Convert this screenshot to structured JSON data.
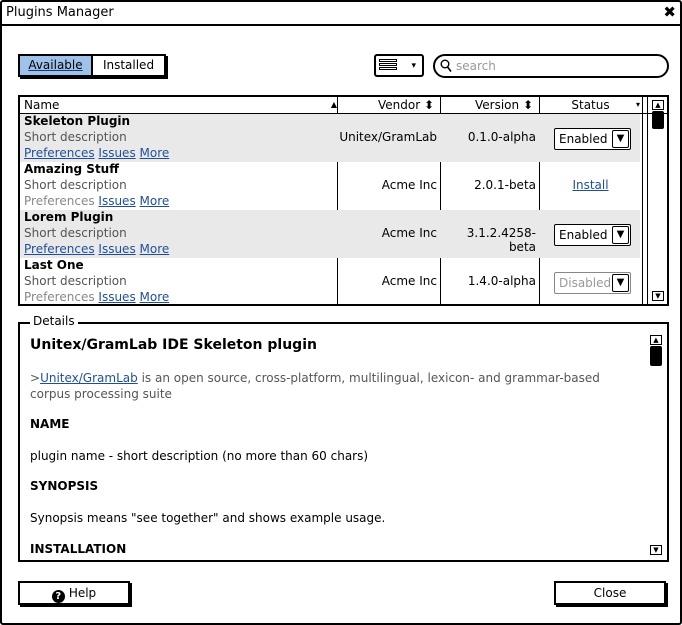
{
  "window": {
    "title": "Plugins Manager",
    "close_glyph": "✖"
  },
  "toolbar": {
    "tabs": [
      {
        "label": "Available",
        "active": true
      },
      {
        "label": "Installed",
        "active": false
      }
    ],
    "view_icon": "list-view-icon",
    "view_caret": "▾",
    "search": {
      "placeholder": "search",
      "value": ""
    }
  },
  "table": {
    "columns": {
      "name": "Name",
      "name_sort": "▲",
      "vendor": "Vendor ⬍",
      "version": "Version ⬍",
      "status": "Status",
      "status_dd": "▾"
    },
    "rows": [
      {
        "name": "Skeleton Plugin",
        "desc": "Short description",
        "links": [
          "Preferences",
          "Issues",
          "More"
        ],
        "prefs_enabled": true,
        "vendor": "Unitex/GramLab",
        "version": "0.1.0-alpha",
        "status": "Enabled",
        "status_type": "select"
      },
      {
        "name": "Amazing Stuff",
        "desc": "Short description",
        "links": [
          "Preferences",
          "Issues",
          "More"
        ],
        "prefs_enabled": false,
        "vendor": "Acme Inc",
        "version": "2.0.1-beta",
        "status": "Install",
        "status_type": "link"
      },
      {
        "name": "Lorem Plugin",
        "desc": "Short description",
        "links": [
          "Preferences",
          "Issues",
          "More"
        ],
        "prefs_enabled": true,
        "vendor": "Acme Inc",
        "version": "3.1.2.4258-beta",
        "status": "Enabled",
        "status_type": "select"
      },
      {
        "name": "Last One",
        "desc": "Short description",
        "links": [
          "Preferences",
          "Issues",
          "More"
        ],
        "prefs_enabled": false,
        "vendor": "Acme Inc",
        "version": "1.4.0-alpha",
        "status": "Disabled",
        "status_type": "select-disabled"
      }
    ],
    "select_arrow": "▼"
  },
  "details": {
    "legend": "Details",
    "title": "Unitex/GramLab IDE Skeleton plugin",
    "intro_prefix": ">",
    "intro_link": "Unitex/GramLab",
    "intro_text": " is an open source, cross-platform, multilingual, lexicon- and grammar-based corpus processing suite",
    "sections": [
      {
        "heading": "NAME",
        "text": "plugin name - short description (no more than 60 chars)"
      },
      {
        "heading": "SYNOPSIS",
        "text": "Synopsis means \"see together\" and shows example usage."
      },
      {
        "heading": "INSTALLATION",
        "text": ""
      }
    ]
  },
  "footer": {
    "help": "Help",
    "help_icon": "?",
    "close": "Close"
  },
  "scroll_arrows": {
    "up": "▲",
    "down": "▼"
  }
}
